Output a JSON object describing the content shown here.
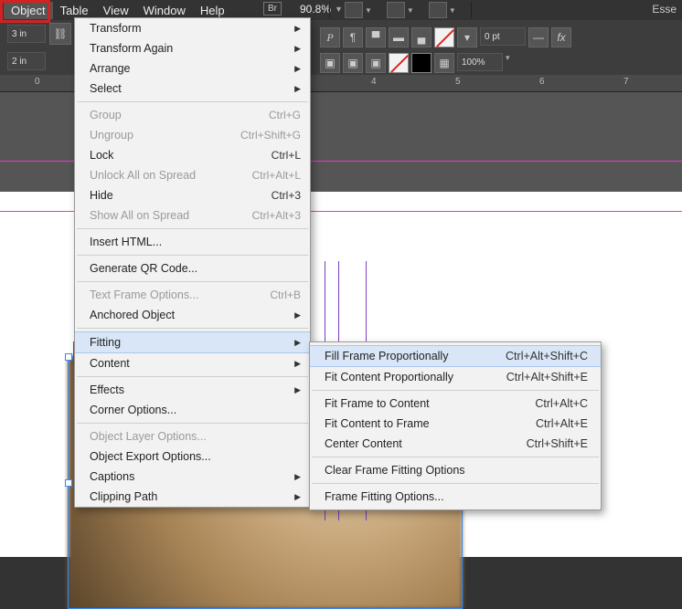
{
  "menubar": {
    "items": [
      "Object",
      "Table",
      "View",
      "Window",
      "Help"
    ],
    "active": "Object",
    "br_label": "Br",
    "zoom": "90.8%",
    "esse_fragment": "Esse"
  },
  "control_panel": {
    "left_field_top": "3 in",
    "left_field_bottom": "2 in",
    "stroke_pt": "0 pt",
    "opacity": "100%"
  },
  "ruler": {
    "marks": [
      {
        "pos": 38,
        "label": "0"
      },
      {
        "pos": 406,
        "label": "4"
      },
      {
        "pos": 498,
        "label": "5"
      },
      {
        "pos": 590,
        "label": "6"
      },
      {
        "pos": 682,
        "label": "7"
      }
    ]
  },
  "object_menu": [
    {
      "label": "Transform",
      "arrow": true
    },
    {
      "label": "Transform Again",
      "arrow": true
    },
    {
      "label": "Arrange",
      "arrow": true
    },
    {
      "label": "Select",
      "arrow": true
    },
    {
      "sep": true
    },
    {
      "label": "Group",
      "shortcut": "Ctrl+G",
      "disabled": true
    },
    {
      "label": "Ungroup",
      "shortcut": "Ctrl+Shift+G",
      "disabled": true
    },
    {
      "label": "Lock",
      "shortcut": "Ctrl+L"
    },
    {
      "label": "Unlock All on Spread",
      "shortcut": "Ctrl+Alt+L",
      "disabled": true
    },
    {
      "label": "Hide",
      "shortcut": "Ctrl+3"
    },
    {
      "label": "Show All on Spread",
      "shortcut": "Ctrl+Alt+3",
      "disabled": true
    },
    {
      "sep": true
    },
    {
      "label": "Insert HTML..."
    },
    {
      "sep": true
    },
    {
      "label": "Generate QR Code..."
    },
    {
      "sep": true
    },
    {
      "label": "Text Frame Options...",
      "shortcut": "Ctrl+B",
      "disabled": true
    },
    {
      "label": "Anchored Object",
      "arrow": true
    },
    {
      "sep": true
    },
    {
      "label": "Fitting",
      "arrow": true,
      "highlight": true
    },
    {
      "label": "Content",
      "arrow": true
    },
    {
      "sep": true
    },
    {
      "label": "Effects",
      "arrow": true
    },
    {
      "label": "Corner Options..."
    },
    {
      "sep": true
    },
    {
      "label": "Object Layer Options...",
      "disabled": true
    },
    {
      "label": "Object Export Options..."
    },
    {
      "label": "Captions",
      "arrow": true
    },
    {
      "label": "Clipping Path",
      "arrow": true
    }
  ],
  "fitting_submenu": [
    {
      "label": "Fill Frame Proportionally",
      "shortcut": "Ctrl+Alt+Shift+C",
      "highlight": true
    },
    {
      "label": "Fit Content Proportionally",
      "shortcut": "Ctrl+Alt+Shift+E"
    },
    {
      "sep": true
    },
    {
      "label": "Fit Frame to Content",
      "shortcut": "Ctrl+Alt+C"
    },
    {
      "label": "Fit Content to Frame",
      "shortcut": "Ctrl+Alt+E"
    },
    {
      "label": "Center Content",
      "shortcut": "Ctrl+Shift+E"
    },
    {
      "sep": true
    },
    {
      "label": "Clear Frame Fitting Options"
    },
    {
      "sep": true
    },
    {
      "label": "Frame Fitting Options..."
    }
  ]
}
